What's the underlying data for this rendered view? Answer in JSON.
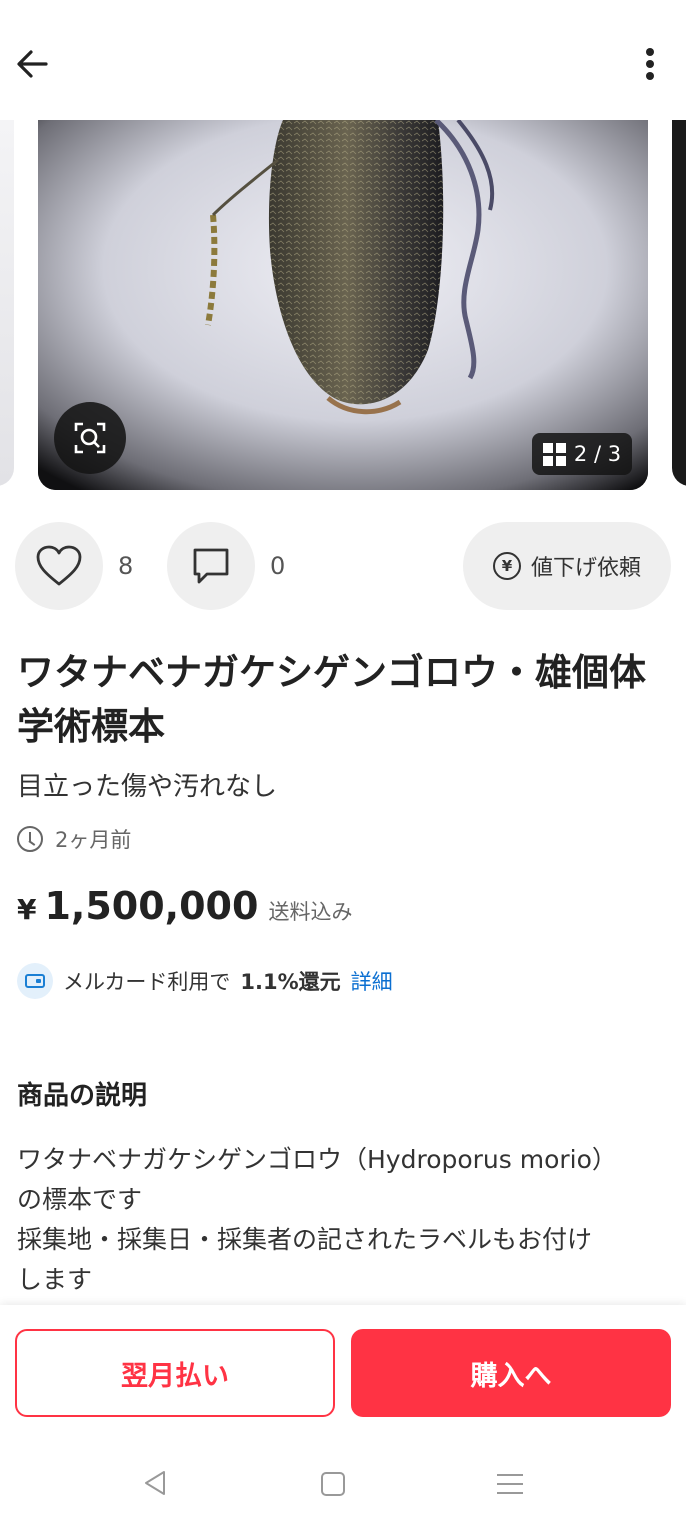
{
  "header": {
    "back_icon": "arrow-left-icon",
    "more_icon": "vertical-dots-icon"
  },
  "gallery": {
    "counter": "2 / 3",
    "lens_icon": "image-search-icon",
    "grid_icon": "grid-icon"
  },
  "actions": {
    "like_icon": "heart-icon",
    "like_count": "8",
    "comment_icon": "comment-icon",
    "comment_count": "0",
    "price_request_icon": "yen-circle-icon",
    "price_request_label": "値下げ依頼"
  },
  "item": {
    "title": "ワタナベナガケシゲンゴロウ・雄個体　学術標本",
    "condition": "目立った傷や汚れなし",
    "posted": "2ヶ月前",
    "currency": "¥",
    "price": "1,500,000",
    "shipping": "送料込み"
  },
  "merpay": {
    "text": "メルカード利用で",
    "rate": "1.1%還元",
    "link": "詳細"
  },
  "description": {
    "heading": "商品の説明",
    "lines": [
      "ワタナベナガケシゲンゴロウ（Hydroporus morio）",
      "の標本です",
      "採集地・採集日・採集者の記されたラベルもお付け",
      "します"
    ]
  },
  "bottom": {
    "monthly_label": "翌月払い",
    "buy_label": "購入へ"
  },
  "colors": {
    "accent": "#ff3344",
    "link": "#0b6fd1"
  }
}
